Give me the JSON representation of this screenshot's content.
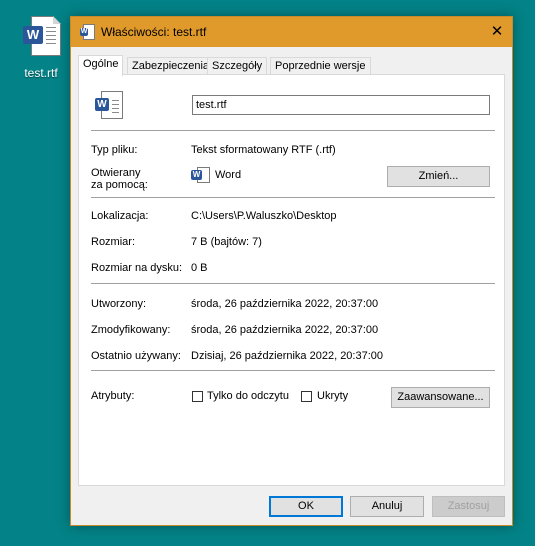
{
  "desktop": {
    "icon_label": "test.rtf",
    "icon": "word-document-icon"
  },
  "dialog": {
    "title": "Właściwości: test.rtf",
    "close_glyph": "✕",
    "tabs": [
      {
        "label": "Ogólne",
        "active": true
      },
      {
        "label": "Zabezpieczenia"
      },
      {
        "label": "Szczegóły"
      },
      {
        "label": "Poprzednie wersje"
      }
    ],
    "general": {
      "file_name": "test.rtf",
      "file_type_label": "Typ pliku:",
      "file_type_value": "Tekst sformatowany RTF (.rtf)",
      "opens_with_label_1": "Otwierany",
      "opens_with_label_2": "za pomocą:",
      "opens_with_app": "Word",
      "change_button": "Zmień...",
      "location_label": "Lokalizacja:",
      "location_value": "C:\\Users\\P.Waluszko\\Desktop",
      "size_label": "Rozmiar:",
      "size_value": "7 B (bajtów: 7)",
      "size_on_disk_label": "Rozmiar na dysku:",
      "size_on_disk_value": "0 B",
      "created_label": "Utworzony:",
      "created_value": "środa, 26 października 2022, 20:37:00",
      "modified_label": "Zmodyfikowany:",
      "modified_value": "środa, 26 października 2022, 20:37:00",
      "accessed_label": "Ostatnio używany:",
      "accessed_value": "Dzisiaj, 26 października 2022, 20:37:00",
      "attributes_label": "Atrybuty:",
      "readonly_label": "Tylko do odczytu",
      "readonly_checked": false,
      "hidden_label": "Ukryty",
      "hidden_checked": false,
      "advanced_button": "Zaawansowane..."
    },
    "buttons": {
      "ok": "OK",
      "cancel": "Anuluj",
      "apply": "Zastosuj"
    }
  },
  "colors": {
    "desktop": "#038387",
    "titlebar": "#e0992b",
    "word_blue": "#2b579a",
    "focus": "#0078d7"
  }
}
